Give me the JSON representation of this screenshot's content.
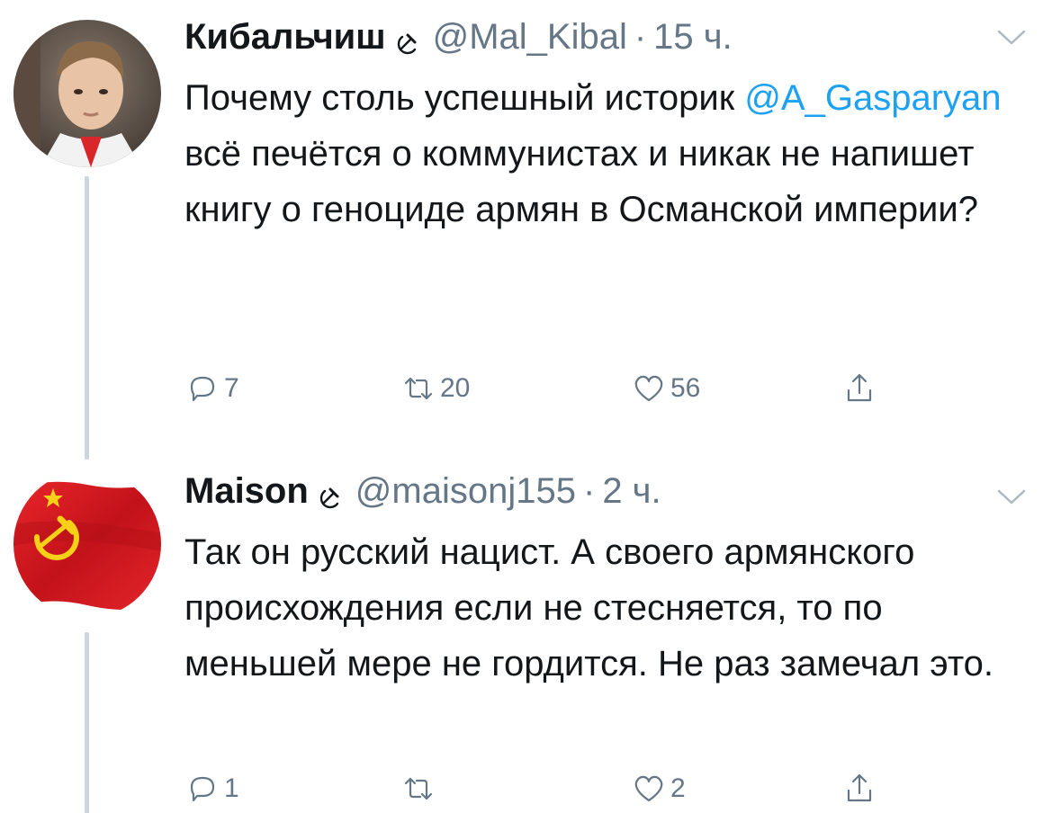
{
  "tweets": [
    {
      "display_name": "Кибальчиш",
      "badge_icon": "hammer-sickle-icon",
      "handle": "@Mal_Kibal",
      "separator": "·",
      "time": "15 ч.",
      "text_before": "Почему столь успешный историк ",
      "mention": "@A_Gasparyan",
      "text_after": " всё печётся о коммунистах и никак не напишет книгу о геноциде армян в Османской империи?",
      "reply_count": "7",
      "retweet_count": "20",
      "like_count": "56"
    },
    {
      "display_name": "Maison",
      "badge_icon": "hammer-sickle-icon",
      "handle": "@maisonj155",
      "separator": "·",
      "time": "2 ч.",
      "text": "Так он русский нацист. А своего армянского происхождения если не стесняется, то по меньшей мере не гордится. Не раз замечал это.",
      "reply_count": "1",
      "retweet_count": "",
      "like_count": "2"
    }
  ],
  "colors": {
    "text": "#14171a",
    "secondary": "#657786",
    "link": "#1da1f2",
    "thread_line": "#ccd6dd",
    "flag_red": "#d4161a",
    "emblem_yellow": "#f7d117"
  }
}
